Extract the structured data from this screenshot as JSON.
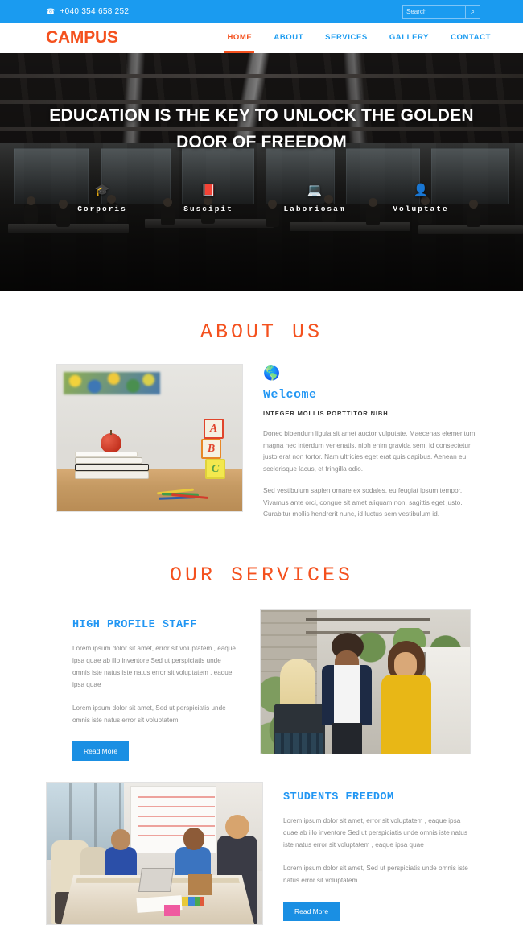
{
  "topbar": {
    "phone": "+040 354 658 252",
    "phone_icon": "phone-icon",
    "search_placeholder": "Search",
    "search_value": "",
    "search_icon": "⌕"
  },
  "header": {
    "logo": "CAMPUS",
    "nav": [
      {
        "label": "HOME",
        "active": true
      },
      {
        "label": "ABOUT",
        "active": false
      },
      {
        "label": "SERVICES",
        "active": false
      },
      {
        "label": "GALLERY",
        "active": false
      },
      {
        "label": "CONTACT",
        "active": false
      }
    ]
  },
  "hero": {
    "title": "EDUCATION IS THE KEY TO UNLOCK THE GOLDEN DOOR OF FREEDOM",
    "features": [
      {
        "label": "Corporis",
        "icon": "🎓",
        "icon_name": "graduation-cap-icon"
      },
      {
        "label": "Suscipit",
        "icon": "📕",
        "icon_name": "book-icon"
      },
      {
        "label": "Laboriosam",
        "icon": "💻",
        "icon_name": "laptop-icon"
      },
      {
        "label": "Voluptate",
        "icon": "👤",
        "icon_name": "user-icon"
      }
    ]
  },
  "about": {
    "section_title": "ABOUT US",
    "image_alt": "classroom desk with apple books pencils and ABC blocks",
    "globe_icon": "🌎",
    "heading": "Welcome",
    "subtitle": "INTEGER MOLLIS PORTTITOR NIBH",
    "paragraph1": "Donec bibendum ligula sit amet auctor vulputate. Maecenas elementum, magna nec interdum venenatis, nibh enim gravida sem, id consectetur justo erat non tortor. Nam ultricies eget erat quis dapibus. Aenean eu scelerisque lacus, et fringilla odio.",
    "paragraph2": "Sed vestibulum sapien ornare ex sodales, eu feugiat ipsum tempor. Vivamus ante orci, congue sit amet aliquam non, sagittis eget justo. Curabitur mollis hendrerit nunc, id luctus sem vestibulum id."
  },
  "services": {
    "section_title": "OUR SERVICES",
    "items": [
      {
        "title": "HIGH PROFILE STAFF",
        "paragraph1": "Lorem ipsum dolor sit amet, error sit voluptatem , eaque ipsa quae ab illo inventore Sed ut perspiciatis unde omnis iste natus iste natus error sit voluptatem , eaque ipsa quae",
        "paragraph2": "Lorem ipsum dolor sit amet, Sed ut perspiciatis unde omnis iste natus error sit voluptatem",
        "button": "Read More",
        "image_alt": "three students talking outdoors"
      },
      {
        "title": "STUDENTS FREEDOM",
        "paragraph1": "Lorem ipsum dolor sit amet, error sit voluptatem , eaque ipsa quae ab illo inventore Sed ut perspiciatis unde omnis iste natus iste natus error sit voluptatem , eaque ipsa quae",
        "paragraph2": "Lorem ipsum dolor sit amet, Sed ut perspiciatis unde omnis iste natus error sit voluptatem",
        "button": "Read More",
        "image_alt": "students collaborating around a table"
      }
    ]
  },
  "colors": {
    "brand_blue": "#1a9bf0",
    "accent_orange": "#f4511e",
    "link_blue": "#2196f3",
    "button_blue": "#1a8fe3",
    "body_text": "#8a8a8a"
  }
}
